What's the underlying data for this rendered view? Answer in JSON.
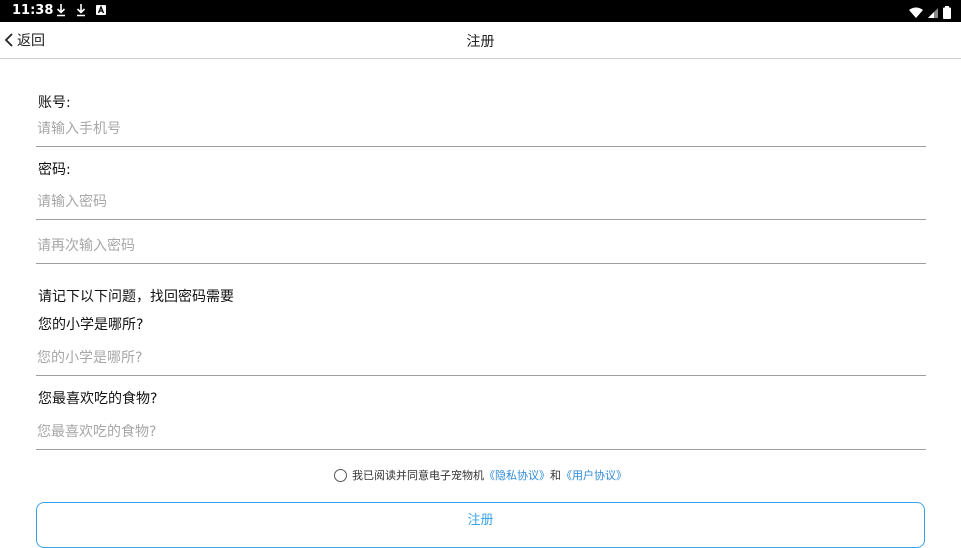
{
  "status_bar": {
    "time": "11:38"
  },
  "header": {
    "back_label": "返回",
    "title": "注册"
  },
  "form": {
    "account_label": "账号:",
    "account_placeholder": "请输入手机号",
    "password_label": "密码:",
    "password_placeholder": "请输入密码",
    "confirm_placeholder": "请再次输入密码",
    "notice": "请记下以下问题，找回密码需要",
    "q1_label": "您的小学是哪所?",
    "q1_placeholder": "您的小学是哪所?",
    "q2_label": "您最喜欢吃的食物?",
    "q2_placeholder": "您最喜欢吃的食物?"
  },
  "agreement": {
    "prefix": "我已阅读并同意电子宠物机",
    "privacy_link": "《隐私协议》",
    "and": "和",
    "user_link": "《用户协议》"
  },
  "submit_label": "注册",
  "colors": {
    "accent": "#38a3e8",
    "link": "#2f8ad8",
    "status_bar": "#000000"
  }
}
